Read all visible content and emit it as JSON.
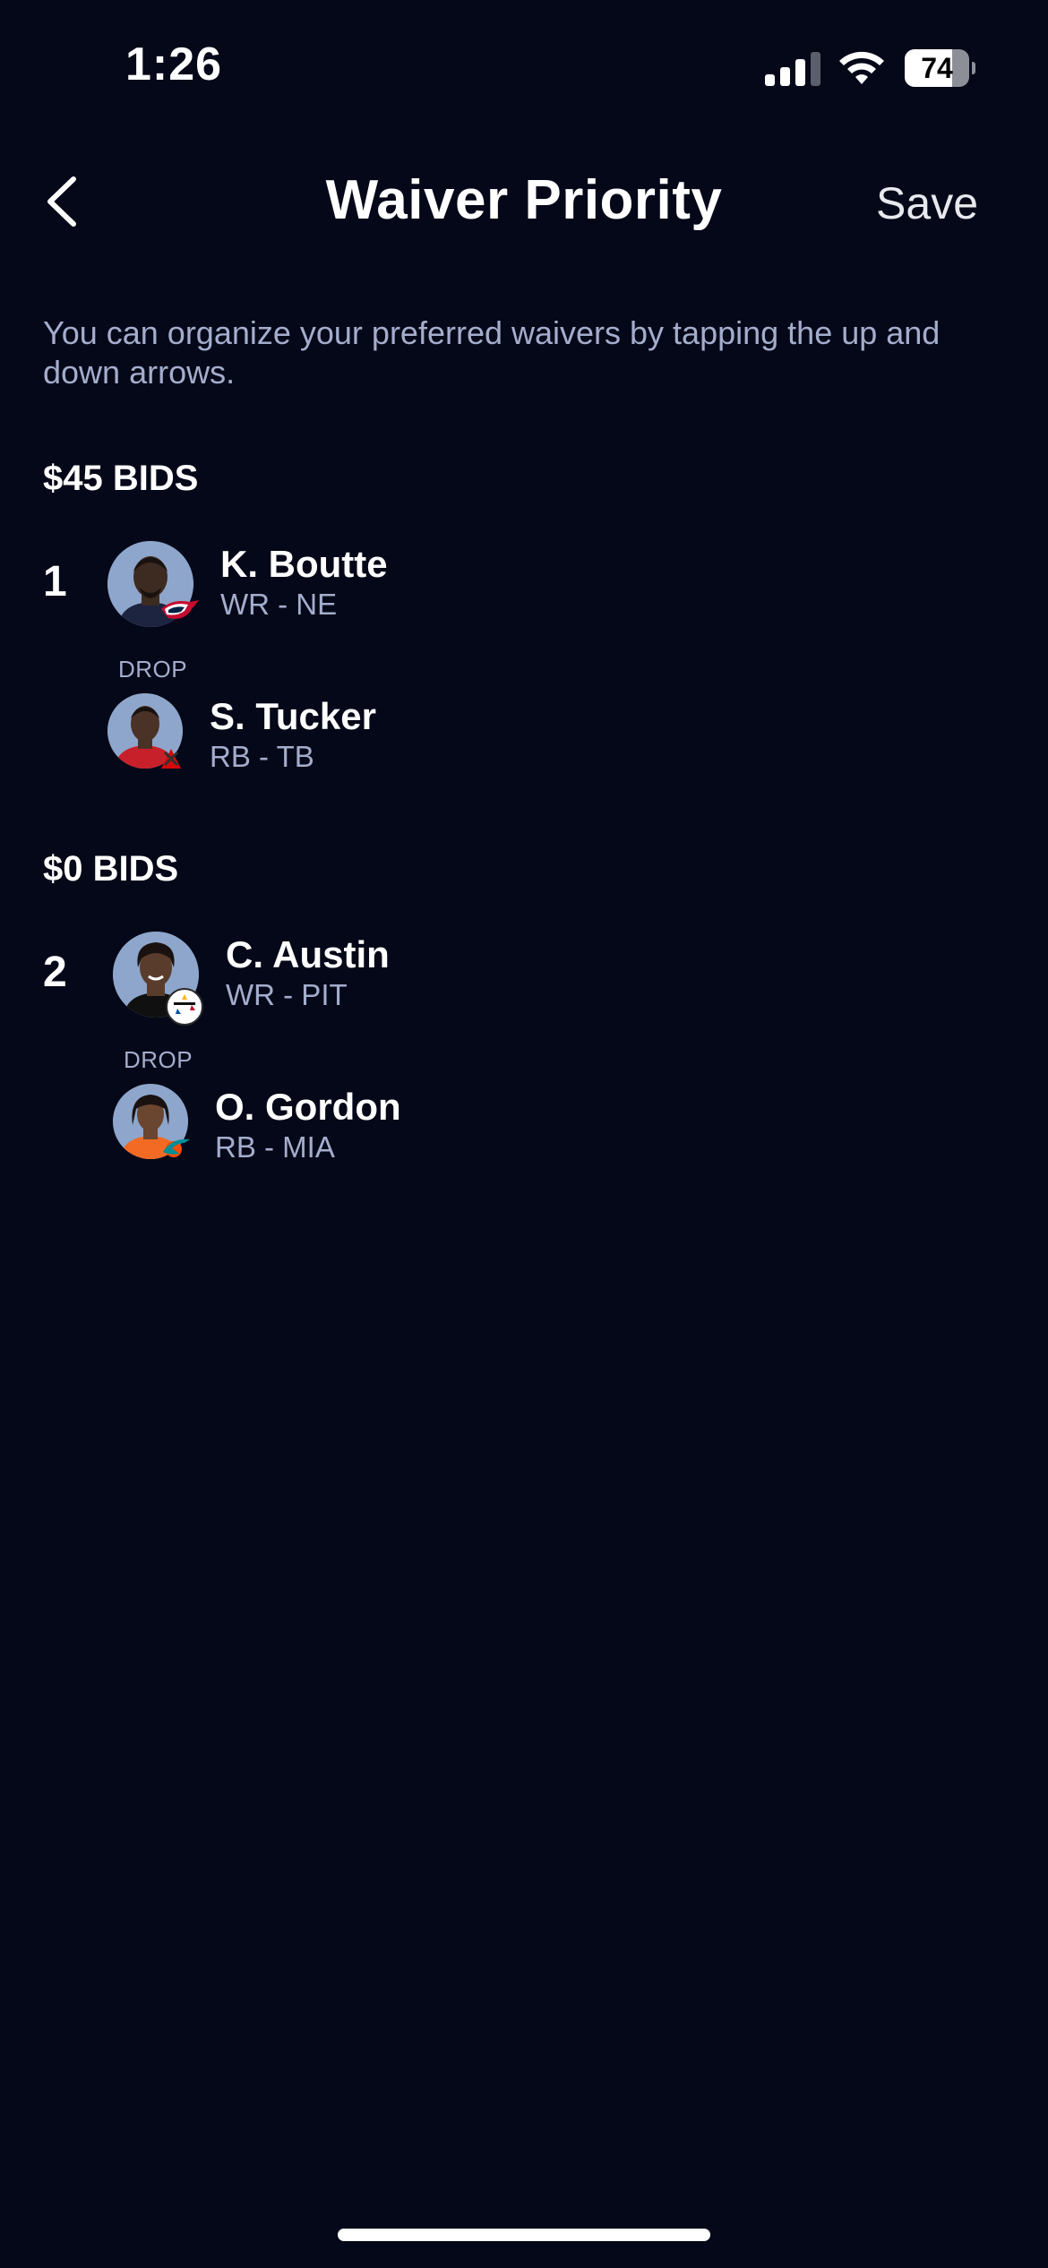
{
  "status_bar": {
    "time": "1:26",
    "battery_level": "74",
    "battery_fraction": 0.74,
    "signal_icon": "cellular-signal-icon",
    "wifi_icon": "wifi-icon",
    "battery_icon": "battery-icon"
  },
  "header": {
    "title": "Waiver Priority",
    "save_label": "Save",
    "back_icon": "chevron-left-icon"
  },
  "description": "You can organize your preferred waivers by tapping the up and down arrows.",
  "groups": [
    {
      "title": "$45 BIDS",
      "rank": "1",
      "add_player": {
        "name": "K. Boutte",
        "position": "WR - NE",
        "team_icon": "patriots-logo-icon"
      },
      "drop_label": "DROP",
      "drop_player": {
        "name": "S. Tucker",
        "position": "RB - TB",
        "team_icon": "buccaneers-logo-icon"
      }
    },
    {
      "title": "$0 BIDS",
      "rank": "2",
      "add_player": {
        "name": "C. Austin",
        "position": "WR - PIT",
        "team_icon": "steelers-logo-icon"
      },
      "drop_label": "DROP",
      "drop_player": {
        "name": "O. Gordon",
        "position": "RB - MIA",
        "team_icon": "dolphins-logo-icon"
      }
    }
  ],
  "colors": {
    "background": "#050818",
    "primary_text": "#ffffff",
    "secondary_text": "#a4adcc",
    "avatar_bg": "#8ea6cb"
  }
}
